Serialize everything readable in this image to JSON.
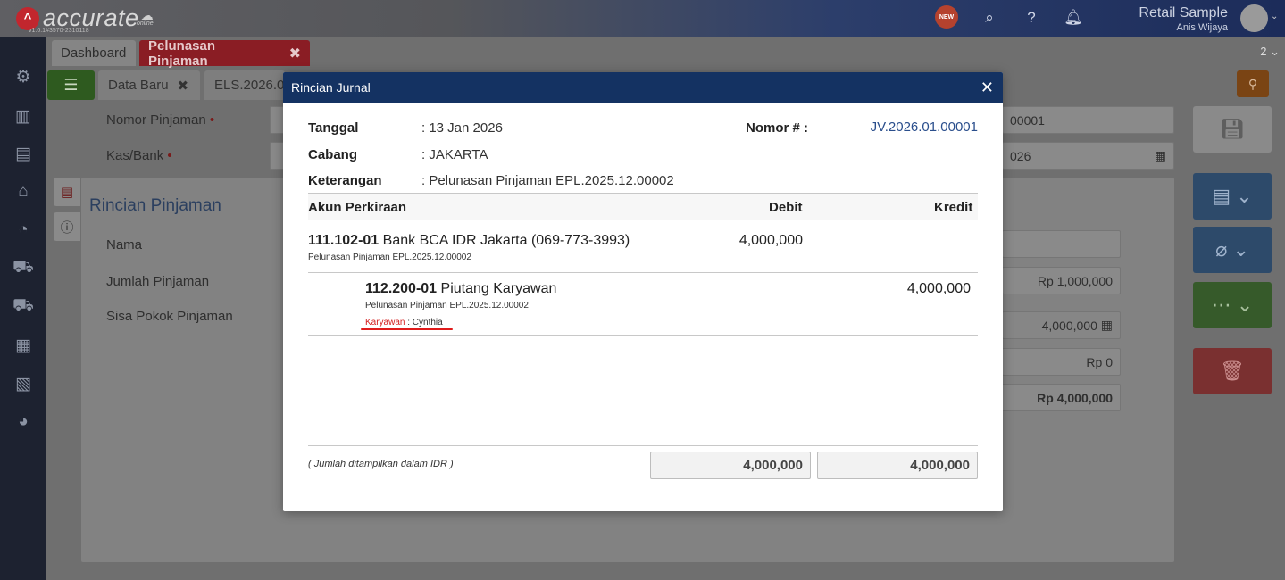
{
  "app": {
    "brand": "accurate",
    "brand_sub": "online",
    "version": "v1.0.1#3570-2310118",
    "new_badge": "NEW",
    "company_name": "Retail Sample",
    "user_name": "Anis Wijaya"
  },
  "tabs": {
    "dashboard": "Dashboard",
    "active": "Pelunasan Pinjaman",
    "count": "2"
  },
  "subtabs": {
    "data_baru": "Data Baru",
    "document": "ELS.2026.0"
  },
  "form": {
    "nomor_pinjaman_label": "Nomor Pinjaman",
    "kas_bank_label": "Kas/Bank",
    "nomor_value": "00001",
    "date_value": "026",
    "panel_title": "Rincian Pinjaman",
    "nama_label": "Nama",
    "jumlah_label": "Jumlah Pinjaman",
    "sisa_label": "Sisa Pokok Pinjaman",
    "jumlah_value": "Rp 1,000,000",
    "bayar_value": "4,000,000",
    "rp0_value": "Rp 0",
    "total_value": "Rp 4,000,000"
  },
  "modal": {
    "title": "Rincian Jurnal",
    "tanggal_label": "Tanggal",
    "tanggal_value": ": 13 Jan 2026",
    "cabang_label": "Cabang",
    "cabang_value": ": JAKARTA",
    "keterangan_label": "Keterangan",
    "keterangan_value": ": Pelunasan Pinjaman EPL.2025.12.00002",
    "nomor_label": "Nomor # :",
    "nomor_value": "JV.2026.01.00001",
    "columns": {
      "akun": "Akun Perkiraan",
      "debit": "Debit",
      "kredit": "Kredit"
    },
    "rows": [
      {
        "code": "111.102-01",
        "name": "Bank BCA IDR Jakarta (069-773-3993)",
        "note": "Pelunasan Pinjaman EPL.2025.12.00002",
        "debit": "4,000,000",
        "kredit": ""
      },
      {
        "code": "112.200-01",
        "name": "Piutang Karyawan",
        "note": "Pelunasan Pinjaman EPL.2025.12.00002",
        "debit": "",
        "kredit": "4,000,000",
        "extra_label": "Karyawan",
        "extra_value": ": Cynthia"
      }
    ],
    "footnote": "( Jumlah ditampilkan dalam IDR )",
    "total_debit": "4,000,000",
    "total_kredit": "4,000,000"
  }
}
